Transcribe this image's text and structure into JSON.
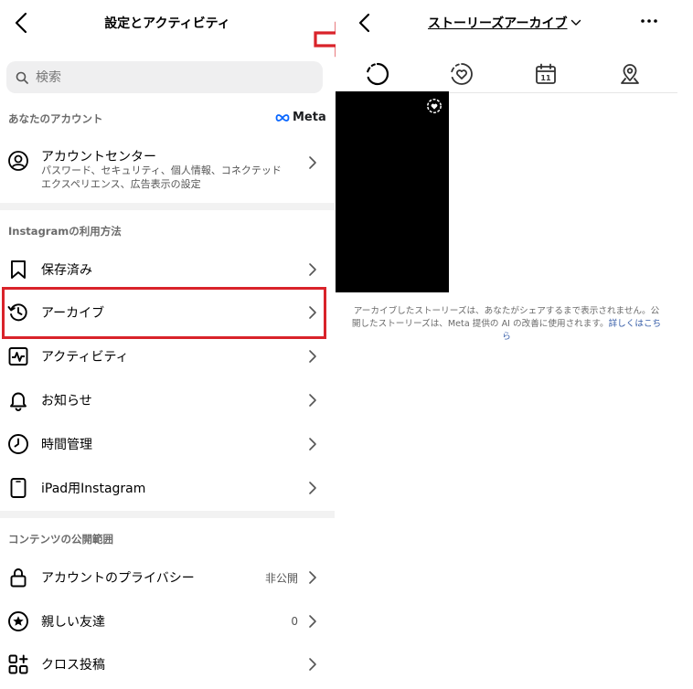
{
  "left": {
    "header": {
      "title": "設定とアクティビティ"
    },
    "search": {
      "placeholder": "検索"
    },
    "section_account": {
      "label": "あなたのアカウント",
      "brand": "Meta"
    },
    "account_center": {
      "label": "アカウントセンター",
      "sub": "パスワード、セキュリティ、個人情報、コネクテッドエクスペリエンス、広告表示の設定"
    },
    "section_usage": {
      "label": "Instagramの利用方法"
    },
    "usage_items": [
      {
        "label": "保存済み",
        "icon": "bookmark-icon"
      },
      {
        "label": "アーカイブ",
        "icon": "archive-history-icon"
      },
      {
        "label": "アクティビティ",
        "icon": "activity-icon"
      },
      {
        "label": "お知らせ",
        "icon": "bell-icon"
      },
      {
        "label": "時間管理",
        "icon": "clock-icon"
      },
      {
        "label": "iPad用Instagram",
        "icon": "ipad-icon"
      }
    ],
    "section_content": {
      "label": "コンテンツの公開範囲"
    },
    "content_items": [
      {
        "label": "アカウントのプライバシー",
        "value": "非公開",
        "icon": "lock-icon"
      },
      {
        "label": "親しい友達",
        "value": "0",
        "icon": "star-circle-icon"
      },
      {
        "label": "クロス投稿",
        "value": "",
        "icon": "cross-post-icon"
      }
    ]
  },
  "right": {
    "title": "ストーリーズアーカイブ",
    "tabs": [
      "stories-archive-icon",
      "highlights-icon",
      "calendar-icon",
      "location-icon"
    ],
    "calendar_day": "11",
    "notice": "アーカイブしたストーリーズは、あなたがシェアするまで表示されません。公開したストーリーズは、Meta 提供の AI の改善に使用されます。",
    "notice_link": "詳しくはこちら"
  },
  "colors": {
    "highlight": "#d9232a",
    "link": "#375da8",
    "arrow": "#d9232a"
  }
}
